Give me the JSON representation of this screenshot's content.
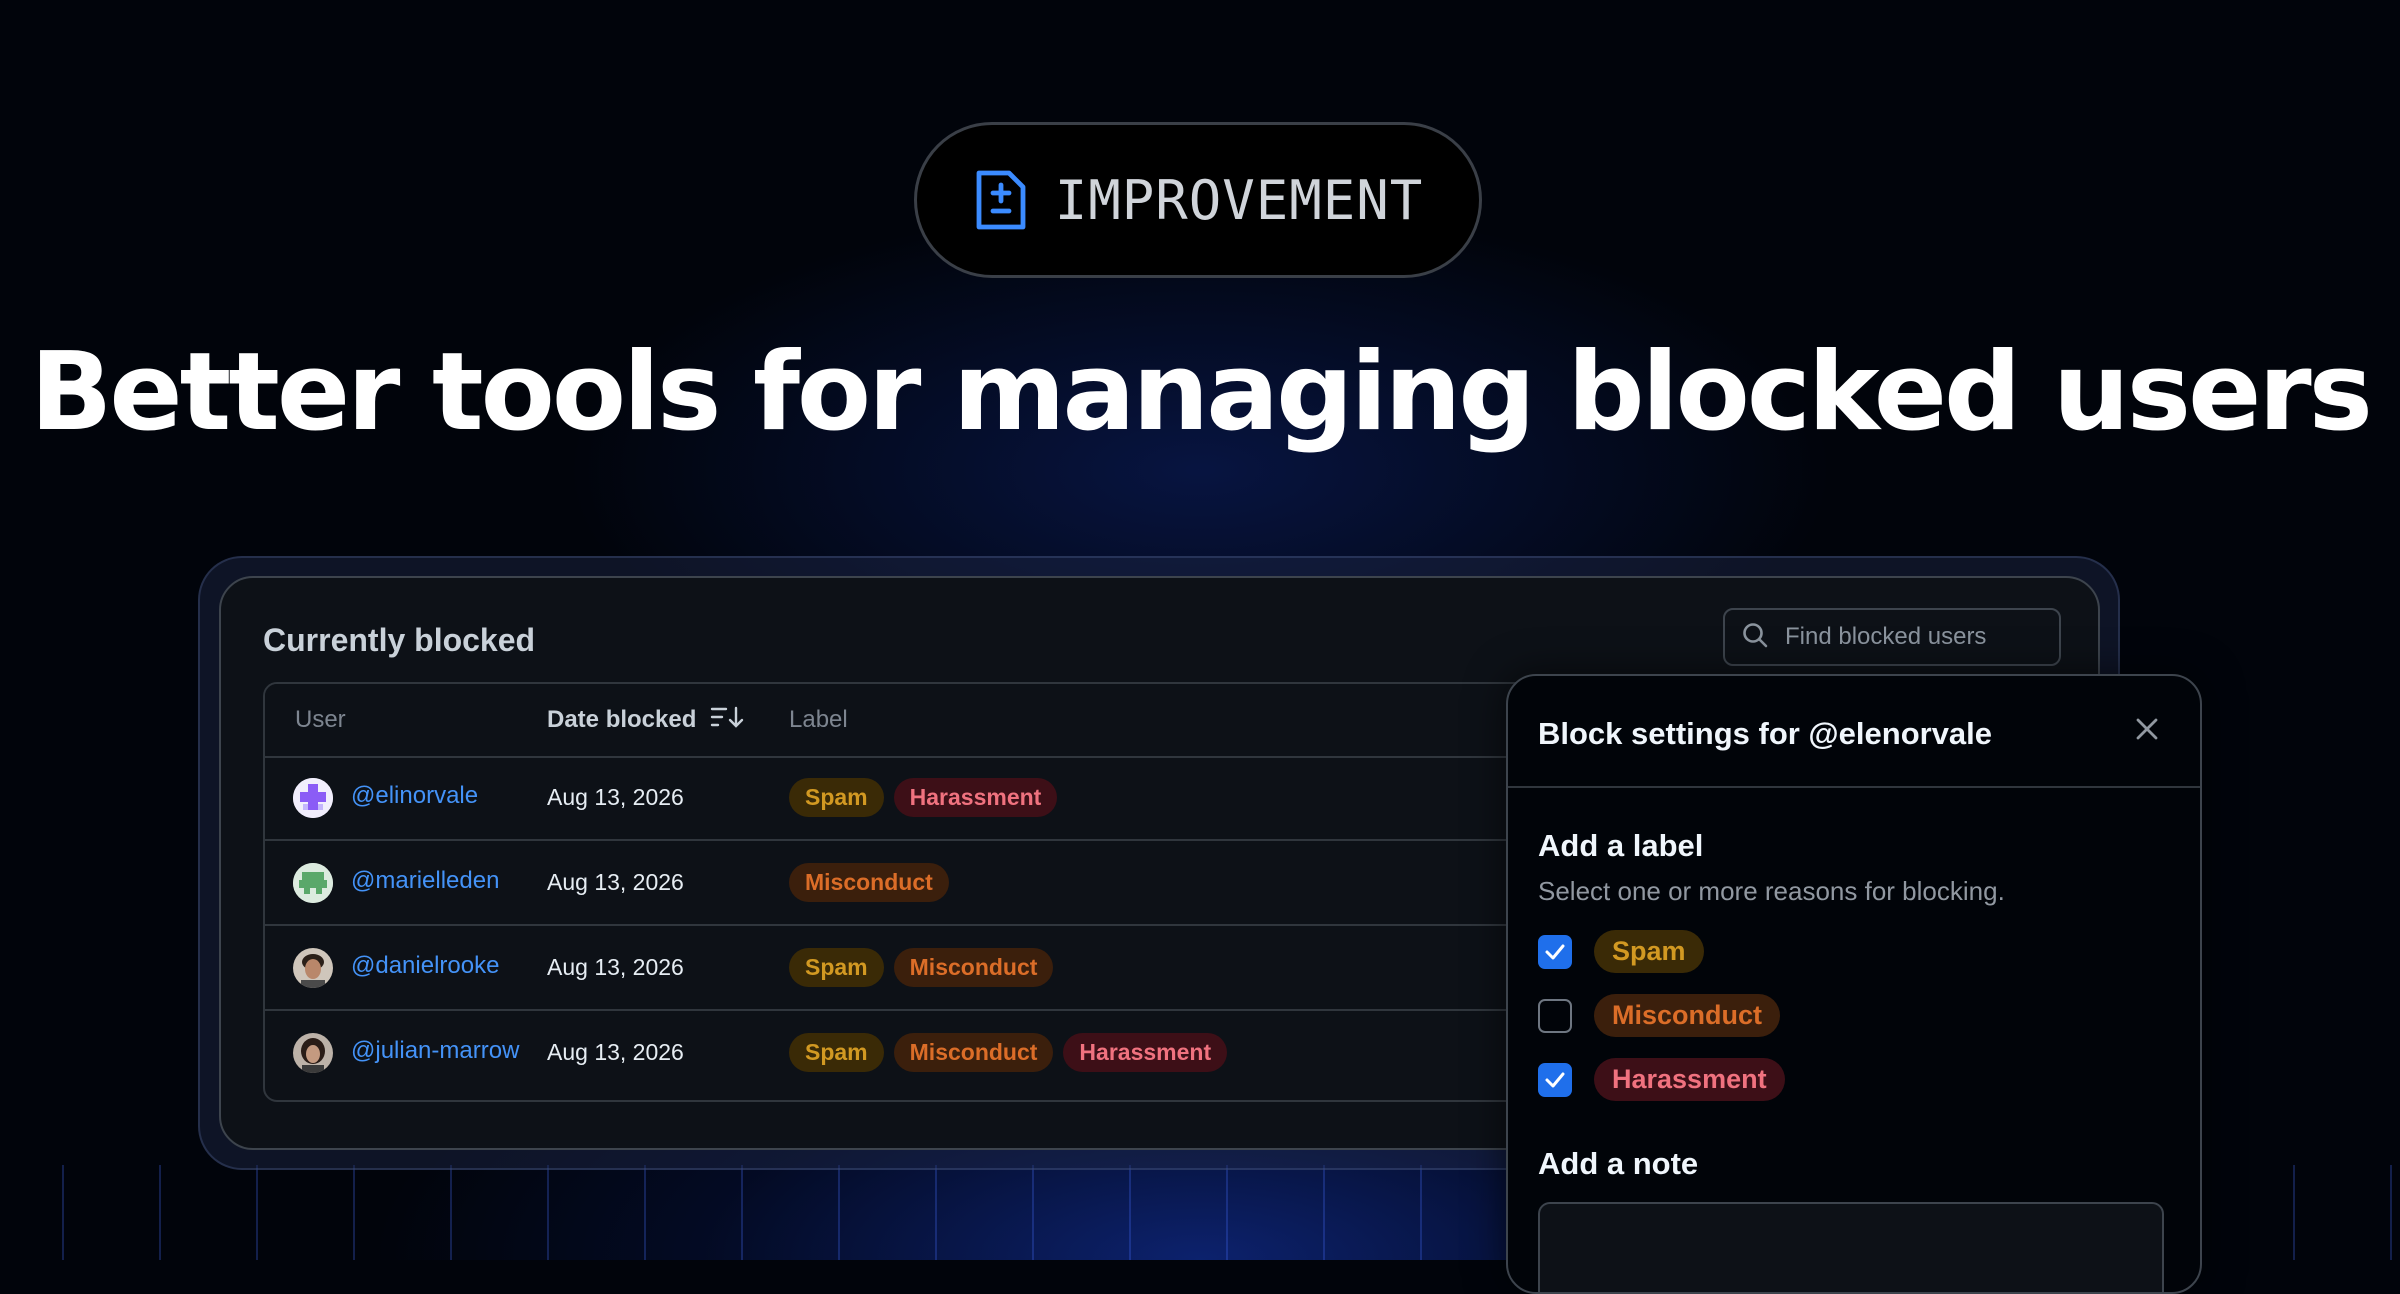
{
  "badge": {
    "label": "IMPROVEMENT",
    "icon": "file-diff-icon"
  },
  "headline": "Better tools for managing blocked users",
  "panel": {
    "title": "Currently blocked",
    "search_placeholder": "Find blocked users",
    "columns": {
      "user": "User",
      "date": "Date blocked",
      "label": "Label"
    },
    "rows": [
      {
        "user": "@elinorvale",
        "date": "Aug 13, 2026",
        "labels": [
          "Spam",
          "Harassment"
        ]
      },
      {
        "user": "@marielleden",
        "date": "Aug 13, 2026",
        "labels": [
          "Misconduct"
        ]
      },
      {
        "user": "@danielrooke",
        "date": "Aug 13, 2026",
        "labels": [
          "Spam",
          "Misconduct"
        ]
      },
      {
        "user": "@julian-marrow",
        "date": "Aug 13, 2026",
        "labels": [
          "Spam",
          "Misconduct",
          "Harassment"
        ]
      }
    ]
  },
  "popover": {
    "title": "Block settings for @elenorvale",
    "add_label_title": "Add a label",
    "add_label_desc": "Select one or more reasons for blocking.",
    "options": [
      {
        "label": "Spam",
        "checked": true
      },
      {
        "label": "Misconduct",
        "checked": false
      },
      {
        "label": "Harassment",
        "checked": true
      }
    ],
    "add_note_title": "Add a note",
    "note_value": ""
  },
  "colors": {
    "accent_blue": "#4493f8",
    "checkbox_blue": "#1f6feb",
    "spam": "#d29922",
    "misconduct": "#db6d28",
    "harassment": "#f0727f"
  }
}
